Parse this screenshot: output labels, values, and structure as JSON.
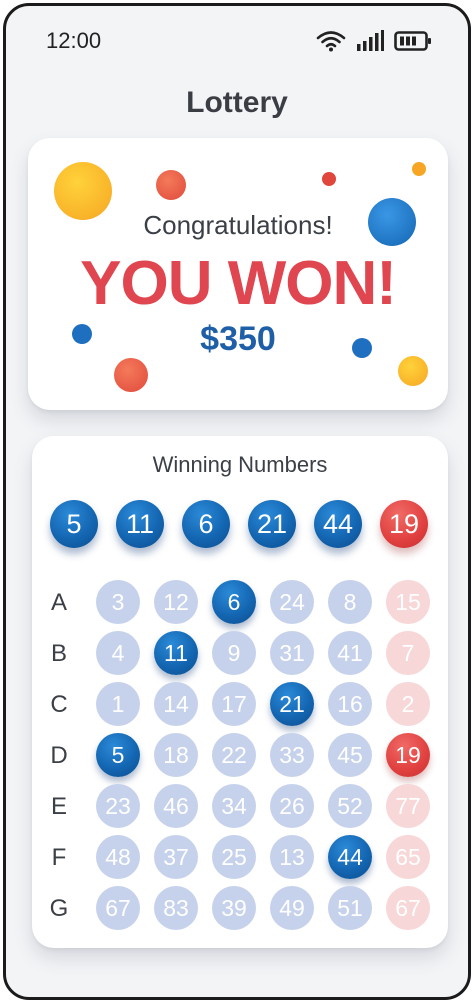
{
  "status": {
    "time": "12:00"
  },
  "app": {
    "title": "Lottery"
  },
  "result": {
    "congrats": "Congratulations!",
    "headline": "YOU WON!",
    "amount": "$350"
  },
  "winning": {
    "title": "Winning Numbers",
    "numbers": [
      "5",
      "11",
      "6",
      "21",
      "44",
      "19"
    ],
    "special_color": "#e0403f",
    "main_color": "#1466b2"
  },
  "grid": {
    "rows": [
      {
        "label": "A",
        "numbers": [
          "3",
          "12",
          "6",
          "24",
          "8",
          "15"
        ],
        "hit": [
          false,
          false,
          true,
          false,
          false,
          false
        ]
      },
      {
        "label": "B",
        "numbers": [
          "4",
          "11",
          "9",
          "31",
          "41",
          "7"
        ],
        "hit": [
          false,
          true,
          false,
          false,
          false,
          false
        ]
      },
      {
        "label": "C",
        "numbers": [
          "1",
          "14",
          "17",
          "21",
          "16",
          "2"
        ],
        "hit": [
          false,
          false,
          false,
          true,
          false,
          false
        ]
      },
      {
        "label": "D",
        "numbers": [
          "5",
          "18",
          "22",
          "33",
          "45",
          "19"
        ],
        "hit": [
          true,
          false,
          false,
          false,
          false,
          true
        ]
      },
      {
        "label": "E",
        "numbers": [
          "23",
          "46",
          "34",
          "26",
          "52",
          "77"
        ],
        "hit": [
          false,
          false,
          false,
          false,
          false,
          false
        ]
      },
      {
        "label": "F",
        "numbers": [
          "48",
          "37",
          "25",
          "13",
          "44",
          "65"
        ],
        "hit": [
          false,
          false,
          false,
          false,
          true,
          false
        ]
      },
      {
        "label": "G",
        "numbers": [
          "67",
          "83",
          "39",
          "49",
          "51",
          "67"
        ],
        "hit": [
          false,
          false,
          false,
          false,
          false,
          false
        ]
      }
    ]
  },
  "colors": {
    "accent_blue": "#1466b2",
    "accent_red": "#e0464f",
    "light_blue": "#c6d2ec",
    "light_red": "#f7d7d7"
  }
}
